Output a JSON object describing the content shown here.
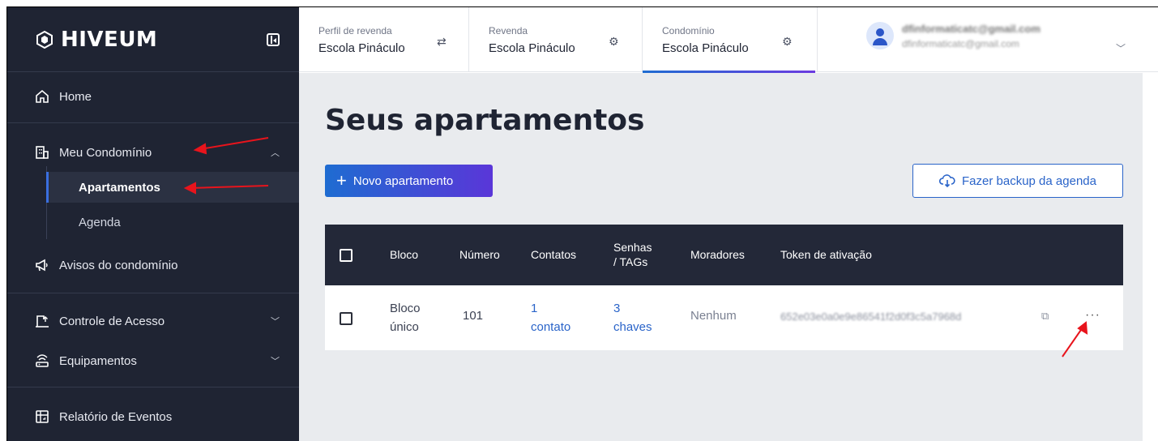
{
  "brand": {
    "name": "HIVEUM"
  },
  "sidebar": {
    "home": "Home",
    "meu_condominio": "Meu Condomínio",
    "apartamentos": "Apartamentos",
    "agenda": "Agenda",
    "avisos": "Avisos do condomínio",
    "controle_acesso": "Controle de Acesso",
    "equipamentos": "Equipamentos",
    "relatorio": "Relatório de Eventos"
  },
  "header": {
    "perfil_label": "Perfil de revenda",
    "perfil_value": "Escola Pináculo",
    "revenda_label": "Revenda",
    "revenda_value": "Escola Pináculo",
    "condominio_label": "Condomínio",
    "condominio_value": "Escola Pináculo",
    "user_email_top": "dfinformaticatc@gmail.com",
    "user_email_bottom": "dfinformaticatc@gmail.com"
  },
  "main": {
    "title": "Seus apartamentos",
    "new_button": "Novo apartamento",
    "backup_button": "Fazer backup da agenda"
  },
  "table": {
    "columns": [
      "Bloco",
      "Número",
      "Contatos",
      "Senhas / TAGs",
      "Moradores",
      "Token de ativação"
    ],
    "col_senhas_1": "Senhas",
    "col_senhas_2": "/ TAGs",
    "rows": [
      {
        "bloco_1": "Bloco",
        "bloco_2": "único",
        "numero": "101",
        "contatos_1": "1",
        "contatos_2": "contato",
        "senhas_1": "3",
        "senhas_2": "chaves",
        "moradores": "Nenhum",
        "token": "652e03e0a0e9e86541f2d0f3c5a7968d",
        "actions": "···"
      }
    ]
  },
  "colors": {
    "sidebar_bg": "#1f2433",
    "accent_blue": "#1e6cd1",
    "accent_purple": "#5a36d8",
    "annotation_red": "#e8141c"
  }
}
